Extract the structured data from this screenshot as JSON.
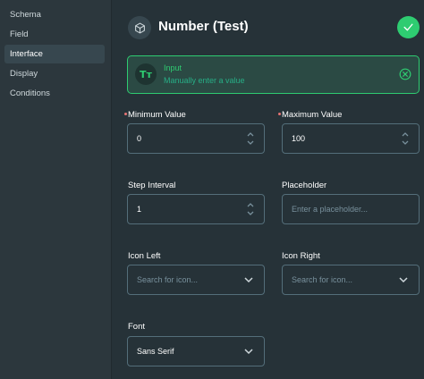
{
  "sidebar": {
    "items": [
      {
        "label": "Schema"
      },
      {
        "label": "Field"
      },
      {
        "label": "Interface"
      },
      {
        "label": "Display"
      },
      {
        "label": "Conditions"
      }
    ],
    "active": "Interface"
  },
  "header": {
    "title": "Number (Test)",
    "icon": "cube-icon",
    "save_icon": "check-icon"
  },
  "interface_card": {
    "icon_text": "Tт",
    "title": "Input",
    "subtitle": "Manually enter a value"
  },
  "fields": {
    "min": {
      "label": "Minimum Value",
      "value": "0",
      "required": true
    },
    "max": {
      "label": "Maximum Value",
      "value": "100",
      "required": true
    },
    "step": {
      "label": "Step Interval",
      "value": "1"
    },
    "placeholder": {
      "label": "Placeholder",
      "placeholder": "Enter a placeholder..."
    },
    "icon_left": {
      "label": "Icon Left",
      "placeholder": "Search for icon..."
    },
    "icon_right": {
      "label": "Icon Right",
      "placeholder": "Search for icon..."
    },
    "font": {
      "label": "Font",
      "value": "Sans Serif"
    }
  },
  "colors": {
    "accent": "#2ecc71",
    "background": "#263238",
    "sidebar": "#2c373d"
  }
}
